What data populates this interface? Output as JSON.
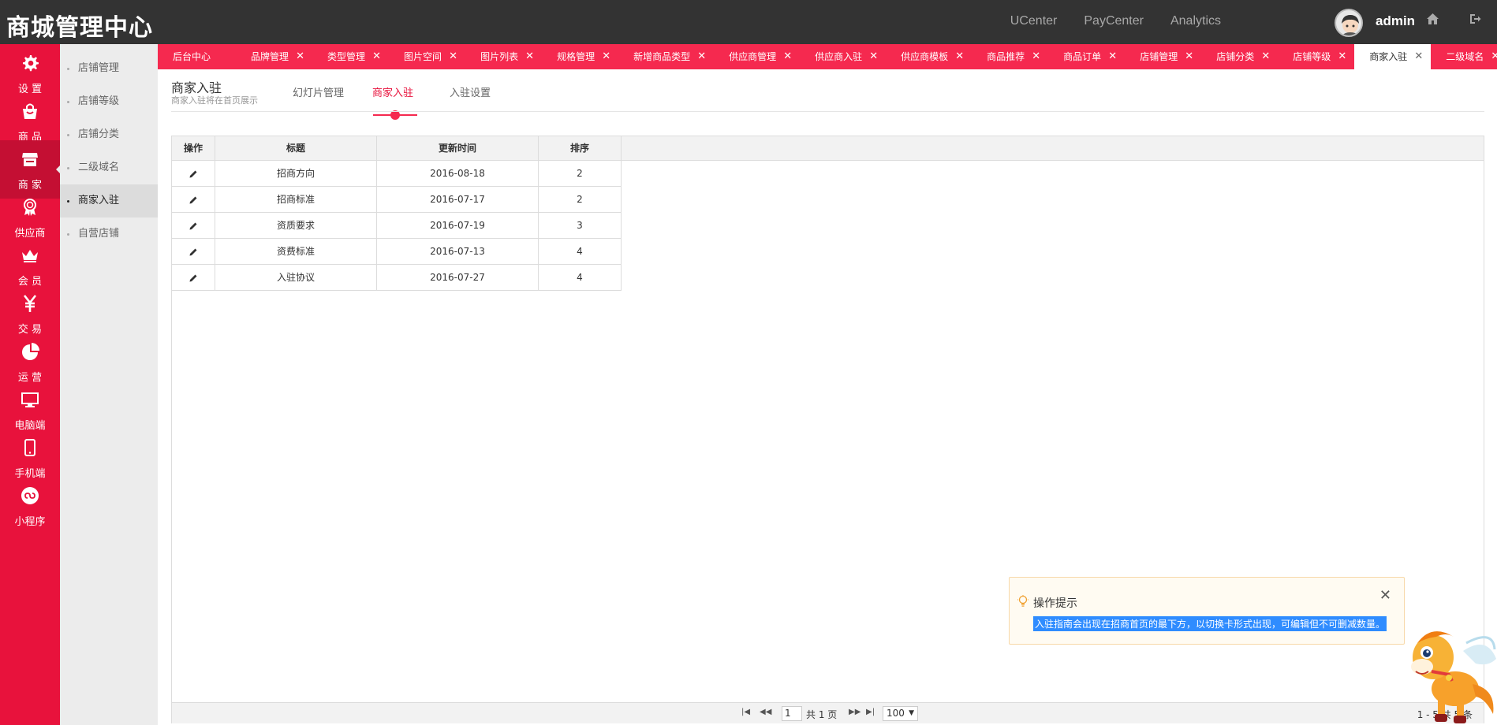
{
  "app": {
    "title": "商城管理中心"
  },
  "top_nav": [
    "UCenter",
    "PayCenter",
    "Analytics"
  ],
  "user": {
    "name": "admin"
  },
  "sidebar": [
    {
      "label": "设 置",
      "icon": "gear-icon"
    },
    {
      "label": "商 品",
      "icon": "bag-icon"
    },
    {
      "label": "商 家",
      "icon": "store-icon"
    },
    {
      "label": "供应商",
      "icon": "medal-icon"
    },
    {
      "label": "会 员",
      "icon": "crown-icon"
    },
    {
      "label": "交 易",
      "icon": "yen-icon"
    },
    {
      "label": "运 营",
      "icon": "pie-icon"
    },
    {
      "label": "电脑端",
      "icon": "monitor-icon"
    },
    {
      "label": "手机端",
      "icon": "phone-icon"
    },
    {
      "label": "小程序",
      "icon": "miniapp-icon"
    }
  ],
  "subnav": [
    "店铺管理",
    "店铺等级",
    "店铺分类",
    "二级域名",
    "商家入驻",
    "自营店铺"
  ],
  "tabs": [
    "后台中心",
    "品牌管理",
    "类型管理",
    "图片空间",
    "图片列表",
    "规格管理",
    "新增商品类型",
    "供应商管理",
    "供应商入驻",
    "供应商模板",
    "商品推荐",
    "商品订单",
    "店铺管理",
    "店铺分类",
    "店铺等级",
    "商家入驻",
    "二级域名"
  ],
  "page": {
    "title": "商家入驻",
    "subtitle": "商家入驻将在首页展示",
    "sections": [
      "幻灯片管理",
      "商家入驻",
      "入驻设置"
    ]
  },
  "table": {
    "headers": [
      "操作",
      "标题",
      "更新时间",
      "排序"
    ],
    "rows": [
      {
        "title": "招商方向",
        "date": "2016-08-18",
        "sort": "2"
      },
      {
        "title": "招商标准",
        "date": "2016-07-17",
        "sort": "2"
      },
      {
        "title": "资质要求",
        "date": "2016-07-19",
        "sort": "3"
      },
      {
        "title": "资费标准",
        "date": "2016-07-13",
        "sort": "4"
      },
      {
        "title": "入驻协议",
        "date": "2016-07-27",
        "sort": "4"
      }
    ]
  },
  "pager": {
    "current": "1",
    "total_label": "共 1 页",
    "page_size": "100",
    "range": "1 - 5 共 5 条"
  },
  "tip": {
    "title": "操作提示",
    "text": "入驻指南会出现在招商首页的最下方，以切换卡形式出现，可编辑但不可删减数量。"
  },
  "colors": {
    "accent": "#e8123c",
    "tab_bar": "#f5294f",
    "topbar": "#333333"
  }
}
